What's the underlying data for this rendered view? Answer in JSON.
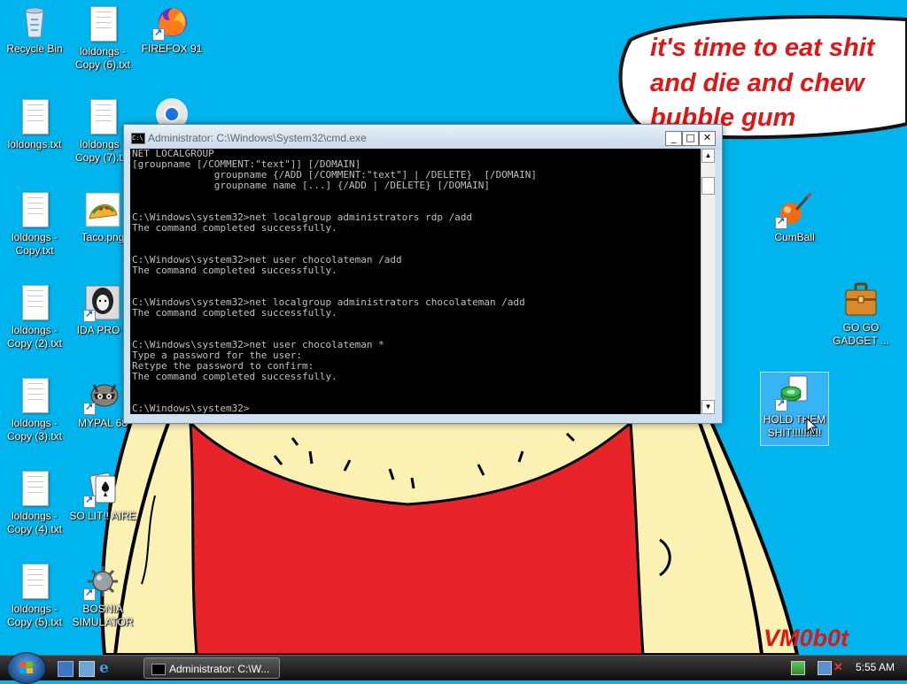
{
  "desktop": {
    "icons": {
      "recycle_bin": "Recycle Bin",
      "loldongs_copy6": "loldongs - Copy (6).txt",
      "firefox": "FIREFOX 91",
      "loldongs": "loldongs.txt",
      "loldongs_copy7": "loldongs - Copy (7).txt",
      "loldongs_copy": "loldongs - Copy.txt",
      "taco": "Taco.png",
      "loldongs_copy2": "loldongs - Copy (2).txt",
      "ida_pro": "IDA PRO 6",
      "loldongs_copy3": "loldongs - Copy (3).txt",
      "mypal": "MYPAL 68",
      "loldongs_copy4": "loldongs - Copy (4).txt",
      "solitaire": "SO LIT!! AIRE",
      "loldongs_copy5": "loldongs - Copy (5).txt",
      "bosnia": "BOSNIA SIMULATOR",
      "cumball": "CumBall",
      "gogo_gadget": "GO GO GADGET ...",
      "hold_them": "HOLD THEM SHIT!!!!!!!!!!"
    }
  },
  "wallpaper": {
    "speech_line1": "it's time to eat shit",
    "speech_line2": "and die and chew",
    "speech_line3": "bubble gum",
    "signature": "VM0b0t",
    "colors": {
      "sky": "#00b4ee",
      "shirt": "#e8242a",
      "skin": "#fbf1b3",
      "bubble_text": "#e01515"
    }
  },
  "cmd_window": {
    "title": "Administrator: C:\\Windows\\System32\\cmd.exe",
    "minimize": "_",
    "maximize": "□",
    "close": "✕",
    "lines": [
      "NET LOCALGROUP",
      "[groupname [/COMMENT:\"text\"]] [/DOMAIN]",
      "              groupname {/ADD [/COMMENT:\"text\"] | /DELETE}  [/DOMAIN]",
      "              groupname name [...] {/ADD | /DELETE} [/DOMAIN]",
      "",
      "",
      "C:\\Windows\\system32>net localgroup administrators rdp /add",
      "The command completed successfully.",
      "",
      "",
      "C:\\Windows\\system32>net user chocolateman /add",
      "The command completed successfully.",
      "",
      "",
      "C:\\Windows\\system32>net localgroup administrators chocolateman /add",
      "The command completed successfully.",
      "",
      "",
      "C:\\Windows\\system32>net user chocolateman *",
      "Type a password for the user:",
      "Retype the password to confirm:",
      "The command completed successfully.",
      "",
      "",
      "C:\\Windows\\system32>"
    ]
  },
  "taskbar": {
    "task_label": "Administrator: C:\\W...",
    "clock": "5:55 AM"
  }
}
